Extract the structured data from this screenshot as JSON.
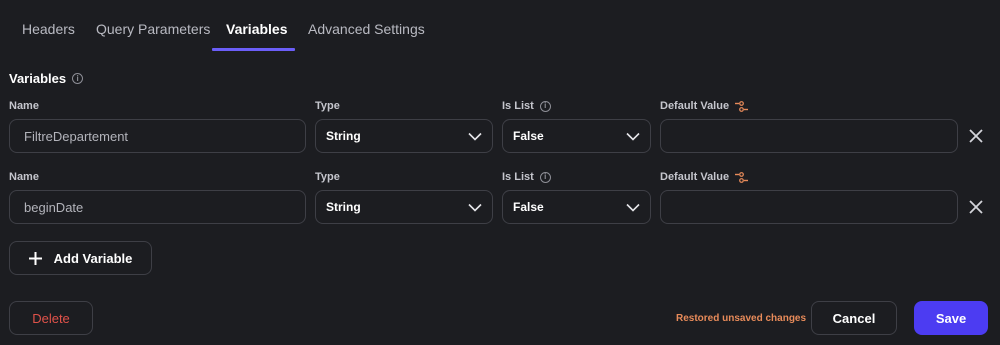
{
  "tabs": [
    {
      "label": "Headers"
    },
    {
      "label": "Query Parameters"
    },
    {
      "label": "Variables",
      "active": true
    },
    {
      "label": "Advanced Settings"
    }
  ],
  "section": {
    "title": "Variables"
  },
  "columns": {
    "name": "Name",
    "type": "Type",
    "is_list": "Is List",
    "default_value": "Default Value"
  },
  "variables": [
    {
      "name": "FiltreDepartement",
      "type": "String",
      "is_list": "False",
      "default_value": ""
    },
    {
      "name": "beginDate",
      "type": "String",
      "is_list": "False",
      "default_value": ""
    }
  ],
  "buttons": {
    "add_variable": "Add Variable",
    "delete": "Delete",
    "cancel": "Cancel",
    "save": "Save"
  },
  "status": {
    "message": "Restored unsaved changes"
  },
  "colors": {
    "background": "#1c1d21",
    "accent": "#6b5ef8",
    "save": "#4c3cf2",
    "danger": "#e0524a",
    "warning": "#e88b5a"
  },
  "icons": [
    "info-icon",
    "tune-icon",
    "chevron-down-icon",
    "close-icon",
    "plus-icon"
  ]
}
